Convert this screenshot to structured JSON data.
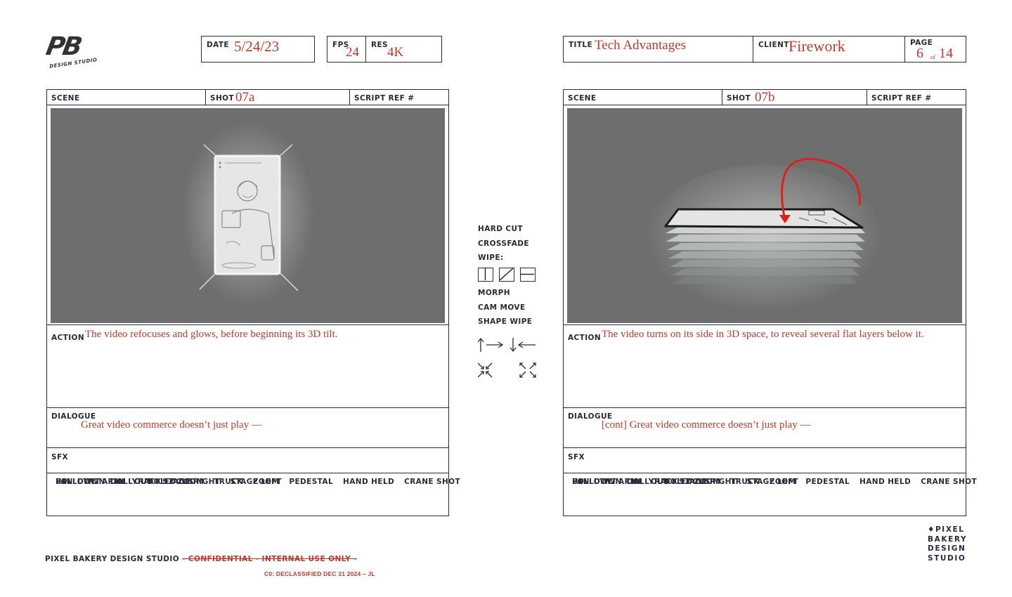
{
  "logo": {
    "initials": "PB",
    "subtitle": "DESIGN STUDIO"
  },
  "meta": {
    "date_label": "DATE",
    "date": "5/24/23",
    "fps_label": "FPS",
    "fps": "24",
    "res_label": "RES",
    "res": "4K",
    "title_label": "TITLE",
    "title": "Tech Advantages",
    "client_label": "CLIENT",
    "client": "Firework",
    "page_label": "PAGE",
    "page": "6",
    "page_of": "of",
    "page_total": "14"
  },
  "labels": {
    "scene": "SCENE",
    "shot": "SHOT",
    "script_ref": "SCRIPT REF #",
    "action": "ACTION",
    "dialogue": "DIALOGUE",
    "sfx": "SFX"
  },
  "camera_moves": {
    "row1": [
      "PAN",
      "TILT",
      "DOLLY",
      "DOLLY ZOOM",
      "TRUCK",
      "ZOOM",
      "PEDESTAL",
      "HAND HELD",
      "CRANE SHOT"
    ],
    "row2": [
      "FOLLOW",
      "ARIAL",
      "RACK FOCUS"
    ],
    "row3": [
      "UP",
      "DOWN",
      "IN",
      "OUT",
      "STAGE RIGHT",
      "STAGE LEFT"
    ]
  },
  "frames": [
    {
      "shot": "07a",
      "action": "The video refocuses and glows, before beginning its 3D tilt.",
      "dialogue": "Great video commerce doesn’t just play —"
    },
    {
      "shot": "07b",
      "action": "The video turns on its side in 3D space, to reveal several flat layers below it.",
      "dialogue": "[cont] Great video commerce doesn’t just play —"
    }
  ],
  "transitions": {
    "items_top": [
      "HARD CUT",
      "CROSSFADE",
      "WIPE:"
    ],
    "items_bottom": [
      "MORPH",
      "CAM MOVE",
      "SHAPE WIPE"
    ]
  },
  "footer": {
    "studio": "PIXEL BAKERY DESIGN STUDIO",
    "confidential": "- CONFIDENTIAL - INTERNAL USE ONLY -",
    "declassified": "C0: DECLASSIFIED DEC 31 2024 – JL"
  },
  "brand_stack": [
    "PIXEL",
    "BAKERY",
    "DESIGN",
    "STUDIO"
  ],
  "colors": {
    "ink": "#2a2a3a",
    "annotation_red": "#c0392b",
    "panel_gray": "#6e6e6e"
  }
}
